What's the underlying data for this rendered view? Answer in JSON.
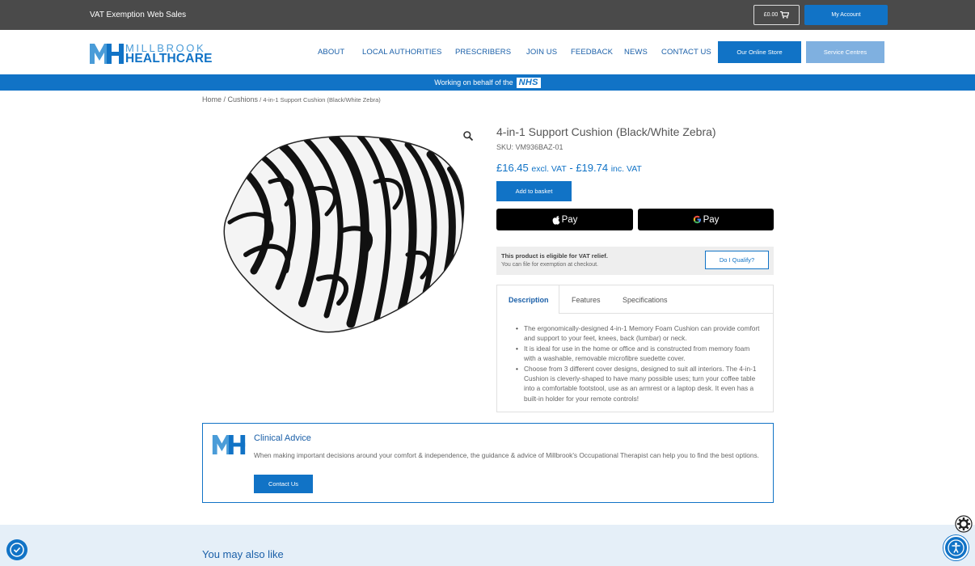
{
  "topbar": {
    "links": [
      "VAT Exemption",
      "Web Sales"
    ],
    "basket_total": "£0.00",
    "account_label": "My Account"
  },
  "header": {
    "logo_line1": "MILLBROOK",
    "logo_line2": "HEALTHCARE",
    "nav": [
      "ABOUT",
      "LOCAL AUTHORITIES",
      "PRESCRIBERS",
      "JOIN US",
      "FEEDBACK",
      "NEWS",
      "CONTACT US"
    ],
    "store_label": "Our Online Store",
    "centres_label": "Service Centres"
  },
  "nhs_strip": {
    "text": "Working on behalf of the",
    "badge": "NHS"
  },
  "breadcrumb": {
    "home": "Home",
    "sep1": " / ",
    "cat": "Cushions",
    "sep2": " / ",
    "current": "4-in-1 Support Cushion (Black/White Zebra)"
  },
  "product": {
    "title": "4-in-1 Support Cushion (Black/White Zebra)",
    "sku": "SKU: VM936BAZ-01",
    "price_ex": "£16.45",
    "ex_label": "excl. VAT",
    "dash": " - ",
    "price_inc": "£19.74",
    "inc_label": "inc. VAT",
    "add_label": "Add to basket",
    "apple_pay": "Pay",
    "google_pay": "Pay",
    "vat_title": "This product is eligible for VAT relief.",
    "vat_sub": "You can file for exemption at checkout.",
    "qualify_label": "Do I Qualify?"
  },
  "tabs": {
    "items": [
      "Description",
      "Features",
      "Specifications"
    ],
    "active": "Description",
    "description": [
      "The ergonomically-designed 4-in-1 Memory Foam Cushion can provide comfort and support to your feet, knees, back (lumbar) or neck.",
      "It is ideal for use in the home or office and is constructed from memory foam with a washable, removable microfibre suedette cover.",
      "Choose from 3 different cover designs, designed to suit all interiors. The 4-in-1 Cushion is cleverly-shaped to have many possible uses; turn your coffee table into a comfortable footstool, use as an armrest or a laptop desk. It even has a built-in holder for your remote controls!"
    ]
  },
  "clinical": {
    "title": "Clinical Advice",
    "text": "When making important decisions around your comfort & independence, the guidance & advice of Millbrook's Occupational Therapist can help you to find the best options.",
    "button": "Contact Us"
  },
  "also_like": "You may also like",
  "colors": {
    "brand_blue": "#1173c6",
    "topbar": "#4a4a4a",
    "light_blue": "#7fb0e0"
  }
}
